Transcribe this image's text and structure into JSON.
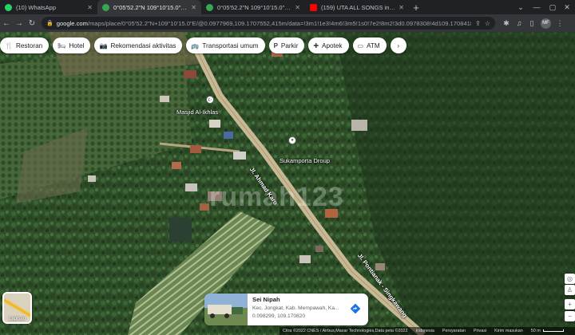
{
  "browser": {
    "tabs": [
      {
        "title": "(10) WhatsApp",
        "active": false,
        "favicon_icon": "whatsapp-icon",
        "favicon_color": "#25d366"
      },
      {
        "title": "0°05'52.2\"N 109°10'15.0\"E - Google Maps",
        "active": true,
        "favicon_icon": "maps-icon",
        "favicon_color": "#34a853"
      },
      {
        "title": "0°05'52.2\"N 109°10'15.0\"E - Google Maps",
        "active": false,
        "favicon_icon": "maps-icon",
        "favicon_color": "#34a853"
      },
      {
        "title": "(159) UTA ALL SONGS in One",
        "active": false,
        "favicon_icon": "youtube-icon",
        "favicon_color": "#ff0000"
      }
    ],
    "new_tab": "+",
    "window_controls": {
      "minimize": "—",
      "maximize": "▢",
      "close": "✕"
    },
    "address": {
      "host": "google.com",
      "path": "/maps/place/0°05'52.2\"N+109°10'15.0\"E/@0.0977969,109.1707552,415m/data=!3m1!1e3!4m6!3m5!1s0!7e2!8m2!3d0.0978308!4d109.1708418"
    },
    "profile_initials": "MF"
  },
  "map": {
    "categories": [
      {
        "label": "Restoran",
        "icon": "fork-knife-icon",
        "glyph": "🍴"
      },
      {
        "label": "Hotel",
        "icon": "bed-icon",
        "glyph": "🛏"
      },
      {
        "label": "Rekomendasi aktivitas",
        "icon": "camera-icon",
        "glyph": "📷"
      },
      {
        "label": "Transportasi umum",
        "icon": "bus-icon",
        "glyph": "🚌"
      },
      {
        "label": "Parkir",
        "icon": "parking-icon",
        "glyph": "P"
      },
      {
        "label": "Apotek",
        "icon": "pharmacy-icon",
        "glyph": "✚"
      },
      {
        "label": "ATM",
        "icon": "atm-icon",
        "glyph": "▭"
      }
    ],
    "chips_more": "›",
    "labels": {
      "mosque": "Masjid Al-Ikhlas",
      "shop": "Sukamporta Droup",
      "road1": "Jl. Ahmad Karo",
      "road2": "Jl. Pontianak - Singkawang"
    },
    "watermark": "rumah123",
    "layers_label": "Lapisan",
    "place": {
      "title": "Sei Nipah",
      "address": "Kec. Jongkat, Kab. Mempawah, Ka...",
      "coords": "0.098299, 109.170820"
    },
    "attribution": {
      "imagery": "Citra ©2022 CNES / Airbus,Maxar Technologies,Data peta ©2022",
      "country": "Indonesia",
      "terms": "Persyaratan",
      "privacy": "Privasi",
      "feedback": "Kirim masukan",
      "scale": "50 m"
    }
  }
}
